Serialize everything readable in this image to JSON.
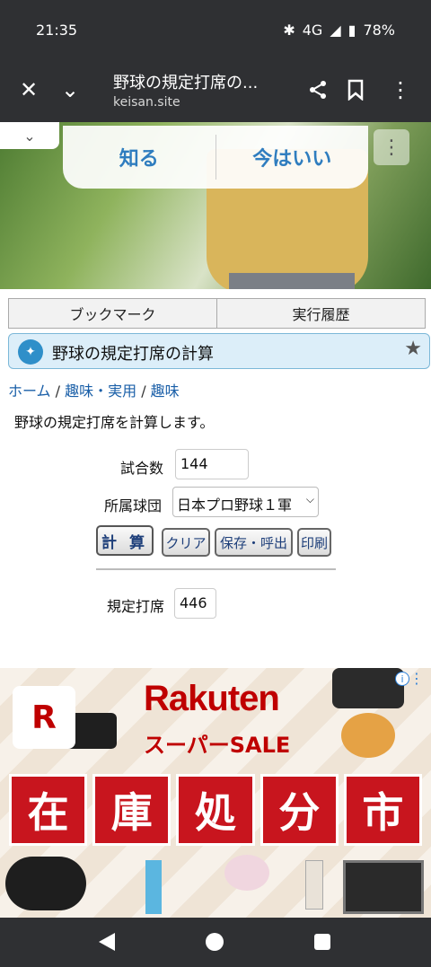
{
  "status": {
    "time": "21:35",
    "network": "4G",
    "battery": "78%"
  },
  "chrome": {
    "page_title": "野球の規定打席の...",
    "host": "keisan.site"
  },
  "prompt": {
    "know_label": "知る",
    "not_now_label": "今はいい"
  },
  "tabs": {
    "bookmark": "ブックマーク",
    "history": "実行履歴"
  },
  "page": {
    "title": "野球の規定打席の計算",
    "breadcrumb": {
      "home": "ホーム",
      "sep1": " / ",
      "category": "趣味・実用",
      "sep2": " / ",
      "sub": "趣味"
    },
    "description": "野球の規定打席を計算します。"
  },
  "form": {
    "games_label": "試合数",
    "games_value": "144",
    "team_label": "所属球団",
    "team_value": "日本プロ野球１軍",
    "calc_button": "計 算",
    "clear_button": "クリア",
    "save_button": "保存・呼出",
    "print_button": "印刷",
    "result_label": "規定打席",
    "result_value": "446"
  },
  "ad": {
    "brand": "Rakuten",
    "subtitle": "スーパーSALE",
    "logo_letter": "R",
    "banner_chars": [
      "在",
      "庫",
      "処",
      "分",
      "市"
    ]
  }
}
